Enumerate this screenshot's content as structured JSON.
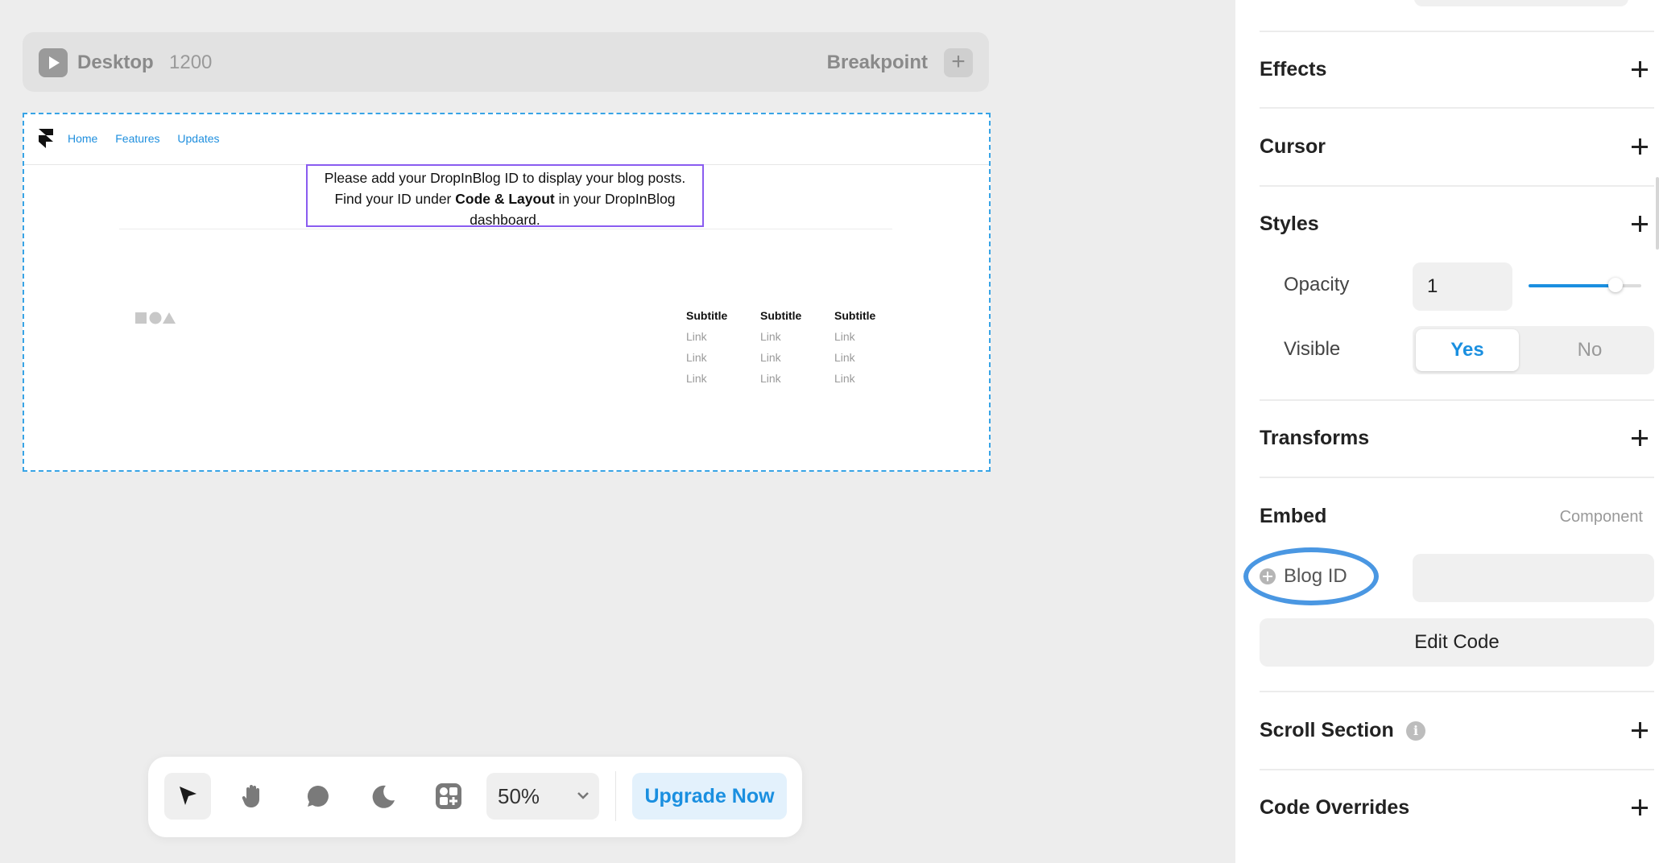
{
  "breakpoint_bar": {
    "device": "Desktop",
    "width": "1200",
    "breakpoint_label": "Breakpoint",
    "add_icon": "plus-icon",
    "play_icon": "play-icon"
  },
  "frame": {
    "nav": [
      "Home",
      "Features",
      "Updates"
    ],
    "message_line1": "Please add your DropInBlog ID to display your blog posts.",
    "message_line2_pre": "Find your ID under ",
    "message_line2_bold": "Code & Layout",
    "message_line2_post": " in your DropInBlog",
    "message_line3": "dashboard.",
    "footer_columns": [
      {
        "subtitle": "Subtitle",
        "links": [
          "Link",
          "Link",
          "Link"
        ]
      },
      {
        "subtitle": "Subtitle",
        "links": [
          "Link",
          "Link",
          "Link"
        ]
      },
      {
        "subtitle": "Subtitle",
        "links": [
          "Link",
          "Link",
          "Link"
        ]
      }
    ]
  },
  "toolbar": {
    "tools": [
      "select-arrow-icon",
      "hand-icon",
      "comment-icon",
      "moon-icon",
      "components-icon"
    ],
    "zoom": "50%",
    "upgrade": "Upgrade Now"
  },
  "panel": {
    "sections": {
      "effects": "Effects",
      "cursor": "Cursor",
      "styles": "Styles",
      "transforms": "Transforms",
      "embed": "Embed",
      "scroll_section": "Scroll Section",
      "code_overrides": "Code Overrides"
    },
    "styles": {
      "opacity_label": "Opacity",
      "opacity_value": "1",
      "opacity_fraction": 0.78,
      "visible_label": "Visible",
      "yes": "Yes",
      "no": "No"
    },
    "embed": {
      "component_tag": "Component",
      "blog_id_label": "Blog ID",
      "blog_id_value": "",
      "edit_code": "Edit Code"
    },
    "colors": {
      "accent": "#1a8fe0",
      "highlight_oval": "#4a97e2",
      "frame_border": "#38a4e6",
      "message_border": "#8a5cf0"
    }
  }
}
